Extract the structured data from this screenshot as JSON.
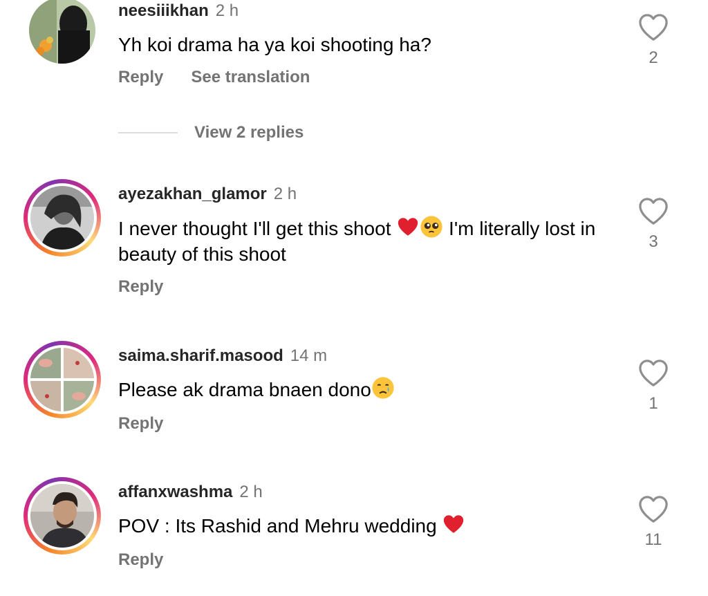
{
  "comments": [
    {
      "username": "neesiiikhan",
      "time": "2 h",
      "text": "Yh koi drama ha ya koi shooting ha?",
      "reply_label": "Reply",
      "translation_label": "See translation",
      "likes": "2",
      "view_replies_label": "View 2 replies"
    },
    {
      "username": "ayezakhan_glamor",
      "time": "2 h",
      "text_part1": "I never thought I'll get this shoot ",
      "text_part2": " I'm literally lost in beauty of this shoot",
      "emojis": [
        "red-heart-emoji",
        "pleading-face-emoji"
      ],
      "reply_label": "Reply",
      "likes": "3"
    },
    {
      "username": "saima.sharif.masood",
      "time": "14 m",
      "text": "Please ak drama bnaen dono",
      "emojis": [
        "crying-face-emoji"
      ],
      "reply_label": "Reply",
      "likes": "1"
    },
    {
      "username": "affanxwashma",
      "time": "2 h",
      "text": "POV : Its Rashid and Mehru wedding ",
      "emojis": [
        "red-heart-emoji"
      ],
      "reply_label": "Reply",
      "likes": "11"
    }
  ],
  "colors": {
    "username": "#262626",
    "secondary_text": "#737373",
    "divider": "#dbdbdb",
    "story_ring_start": "#f58529",
    "story_ring_end": "#dd2a7b"
  },
  "icons": {
    "like": "heart-outline-icon"
  }
}
